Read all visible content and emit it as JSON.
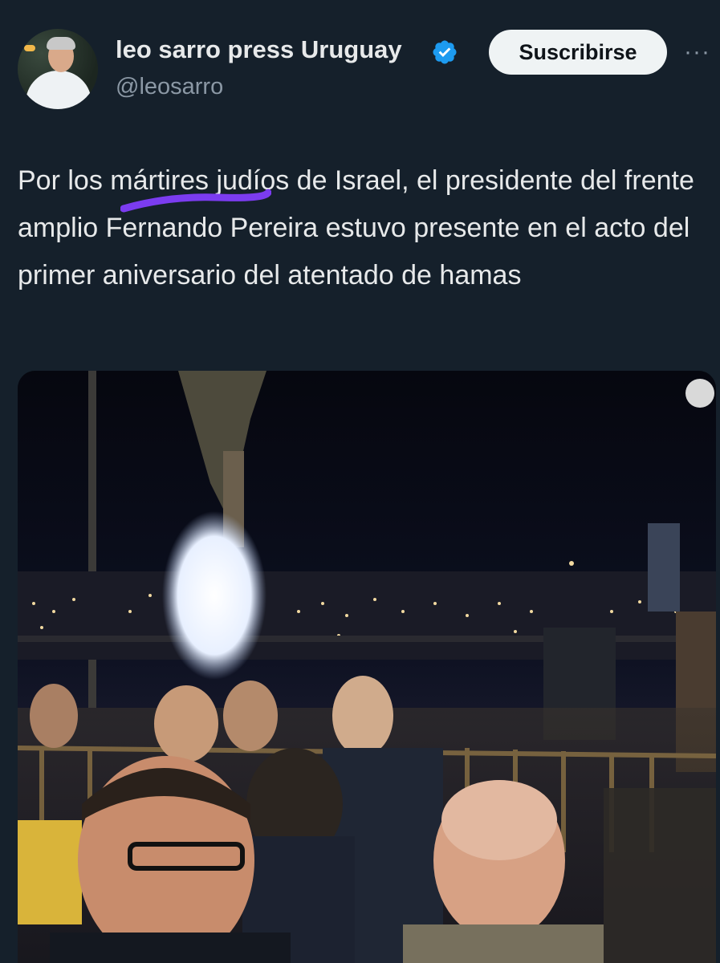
{
  "author": {
    "display_name": "leo sarro press Uruguay",
    "handle": "@leosarro",
    "verified": true,
    "avatar_icon": "profile-photo"
  },
  "actions": {
    "subscribe_label": "Suscribirse",
    "more_icon": "more-horizontal-icon",
    "more_label": "···"
  },
  "tweet": {
    "text": "Por los mártires judíos de Israel, el presidente del frente amplio Fernando Pereira estuvo presente en el acto del primer aniversario del atentado de hamas",
    "highlight_color": "#7b3cf0"
  },
  "media": {
    "type": "photo",
    "description_icon": "night-event-photo"
  },
  "colors": {
    "background": "#15202b",
    "text": "#e7e9ea",
    "secondary": "#8b98a5",
    "verified": "#1d9bf0"
  }
}
